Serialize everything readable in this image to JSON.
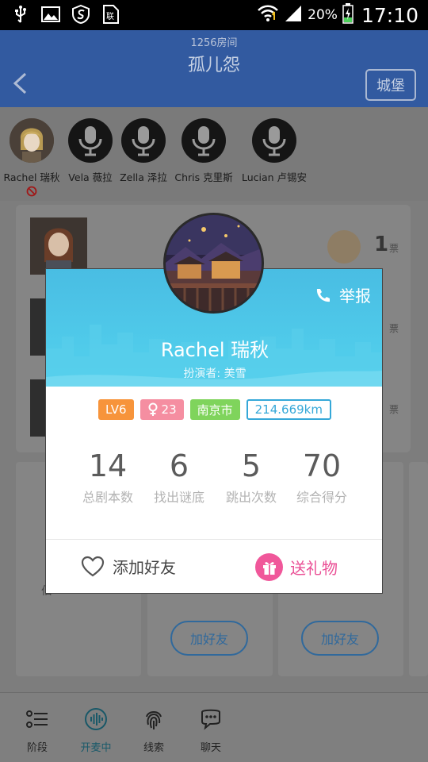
{
  "status_bar": {
    "battery_percent": "20%",
    "time": "17:10",
    "icons": [
      "usb-icon",
      "image-icon",
      "shield-icon",
      "sim-icon",
      "wifi-icon",
      "signal-icon",
      "battery-charging-icon"
    ]
  },
  "header": {
    "room_number": "1256房间",
    "room_name": "孤儿怨",
    "castle_button": "城堡"
  },
  "players": [
    {
      "name": "Rachel 瑞秋",
      "avatar": "character-portrait",
      "muted": true
    },
    {
      "name": "Vela 薇拉",
      "avatar": "microphone-icon"
    },
    {
      "name": "Zella 泽拉",
      "avatar": "microphone-icon"
    },
    {
      "name": "Chris 克里斯",
      "avatar": "microphone-icon"
    },
    {
      "name": "Lucian 卢锡安",
      "avatar": "microphone-icon"
    }
  ],
  "background": {
    "vote_count": "1",
    "vote_label": "票",
    "add_friend_label": "加好友",
    "partial_text": "佰"
  },
  "profile_modal": {
    "report_label": "举报",
    "character_name": "Rachel 瑞秋",
    "actor_line": "扮演者: 美雪",
    "tags": {
      "level": "LV6",
      "age": "23",
      "city": "南京市",
      "distance": "214.669km"
    },
    "stats": [
      {
        "value": "14",
        "label": "总剧本数"
      },
      {
        "value": "6",
        "label": "找出谜底"
      },
      {
        "value": "5",
        "label": "跳出次数"
      },
      {
        "value": "70",
        "label": "综合得分"
      }
    ],
    "add_friend": "添加好友",
    "send_gift": "送礼物"
  },
  "bottom_nav": [
    {
      "label": "阶段",
      "icon": "list-icon"
    },
    {
      "label": "开麦中",
      "icon": "voice-wave-icon",
      "active": true
    },
    {
      "label": "线索",
      "icon": "fingerprint-icon"
    },
    {
      "label": "聊天",
      "icon": "chat-icon"
    }
  ],
  "colors": {
    "modal_header": "#4cc6e8",
    "tag_level": "#f7943b",
    "tag_gender": "#f58ea1",
    "tag_city": "#7fd45c",
    "tag_distance": "#35a8d8",
    "gift_pink": "#ea4f95"
  }
}
